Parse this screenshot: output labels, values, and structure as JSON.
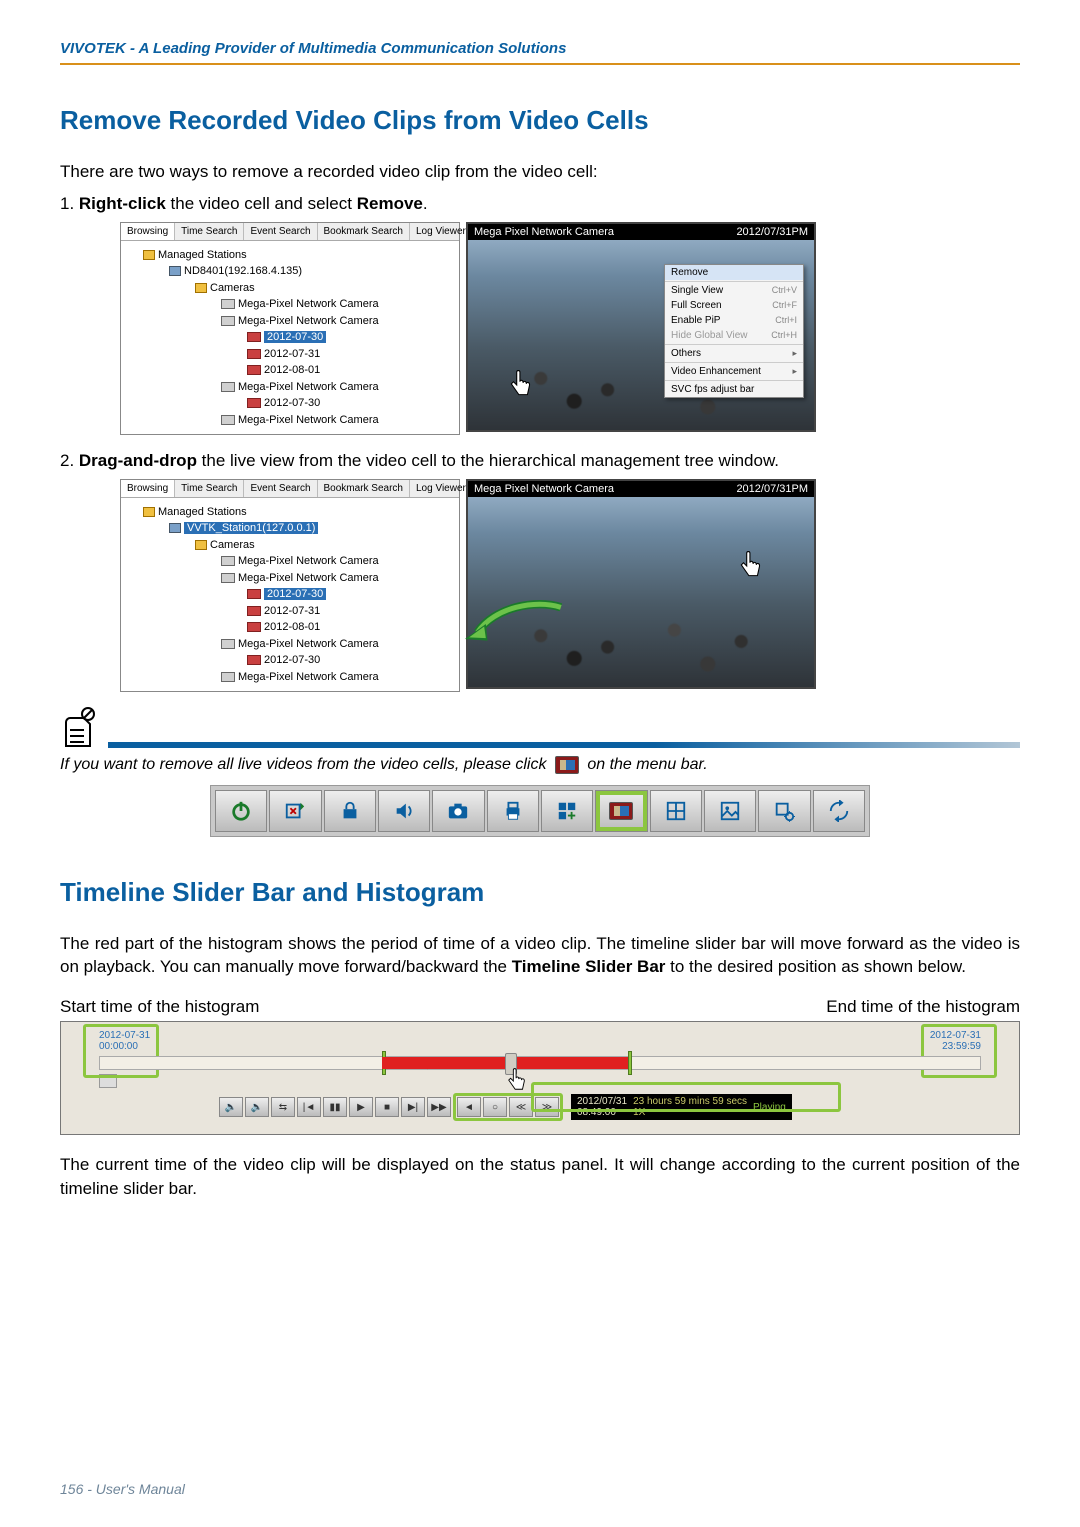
{
  "header": "VIVOTEK - A Leading Provider of Multimedia Communication Solutions",
  "section1": {
    "title": "Remove Recorded Video Clips from Video Cells",
    "intro": "There are two ways to remove a recorded video clip from the video cell:",
    "item1_pre": "1. ",
    "item1_b1": "Right-click",
    "item1_mid": " the video cell and select ",
    "item1_b2": "Remove",
    "item1_post": ".",
    "item2_pre": "2. ",
    "item2_b1": "Drag-and-drop",
    "item2_post": " the live view from the video cell to the hierarchical management tree window."
  },
  "tabs": {
    "t1": "Browsing",
    "t2": "Time Search",
    "t3": "Event Search",
    "t4": "Bookmark Search",
    "t5": "Log Viewer"
  },
  "tree1": {
    "root": "Managed Stations",
    "station": "ND8401(192.168.4.135)",
    "cams": "Cameras",
    "cam": "Mega-Pixel Network Camera",
    "d1": "2012-07-30",
    "d2": "2012-07-31",
    "d3": "2012-08-01"
  },
  "tree2_station": "VVTK_Station1(127.0.0.1)",
  "video_header": {
    "name": "Mega Pixel Network Camera",
    "ts": "2012/07/31PM"
  },
  "ctx": {
    "remove": "Remove",
    "single": "Single View",
    "sc1": "Ctrl+V",
    "full": "Full Screen",
    "sc2": "Ctrl+F",
    "pip": "Enable PiP",
    "sc3": "Ctrl+I",
    "hide": "Hide Global View",
    "sc4": "Ctrl+H",
    "others": "Others",
    "enh": "Video Enhancement",
    "svc": "SVC fps adjust bar"
  },
  "note": {
    "pre": "If you want to remove all live videos from the video cells, please click ",
    "post": " on the menu bar."
  },
  "section2": {
    "title": "Timeline Slider Bar and Histogram",
    "p1_pre": "The red part of the histogram shows the period of time of a video clip. The timeline slider bar will move forward as the video is on playback. You can manually move forward/backward the ",
    "p1_b": "Timeline Slider Bar",
    "p1_post": " to the desired position as shown below.",
    "label_start": "Start time of the histogram",
    "label_end": "End time of the histogram",
    "p2": "The current time of the video clip will be displayed on the status panel. It will change according to the current position of the timeline slider bar."
  },
  "timeline": {
    "start_date": "2012-07-31",
    "start_time": "00:00:00",
    "end_date": "2012-07-31",
    "end_time": "23:59:59",
    "status_date": "2012/07/31",
    "status_time": "08:49:00",
    "status_dur": "23 hours 59 mins 59 secs",
    "status_speed": "1X",
    "status_state": "Playing"
  },
  "footer": "156 - User's Manual"
}
